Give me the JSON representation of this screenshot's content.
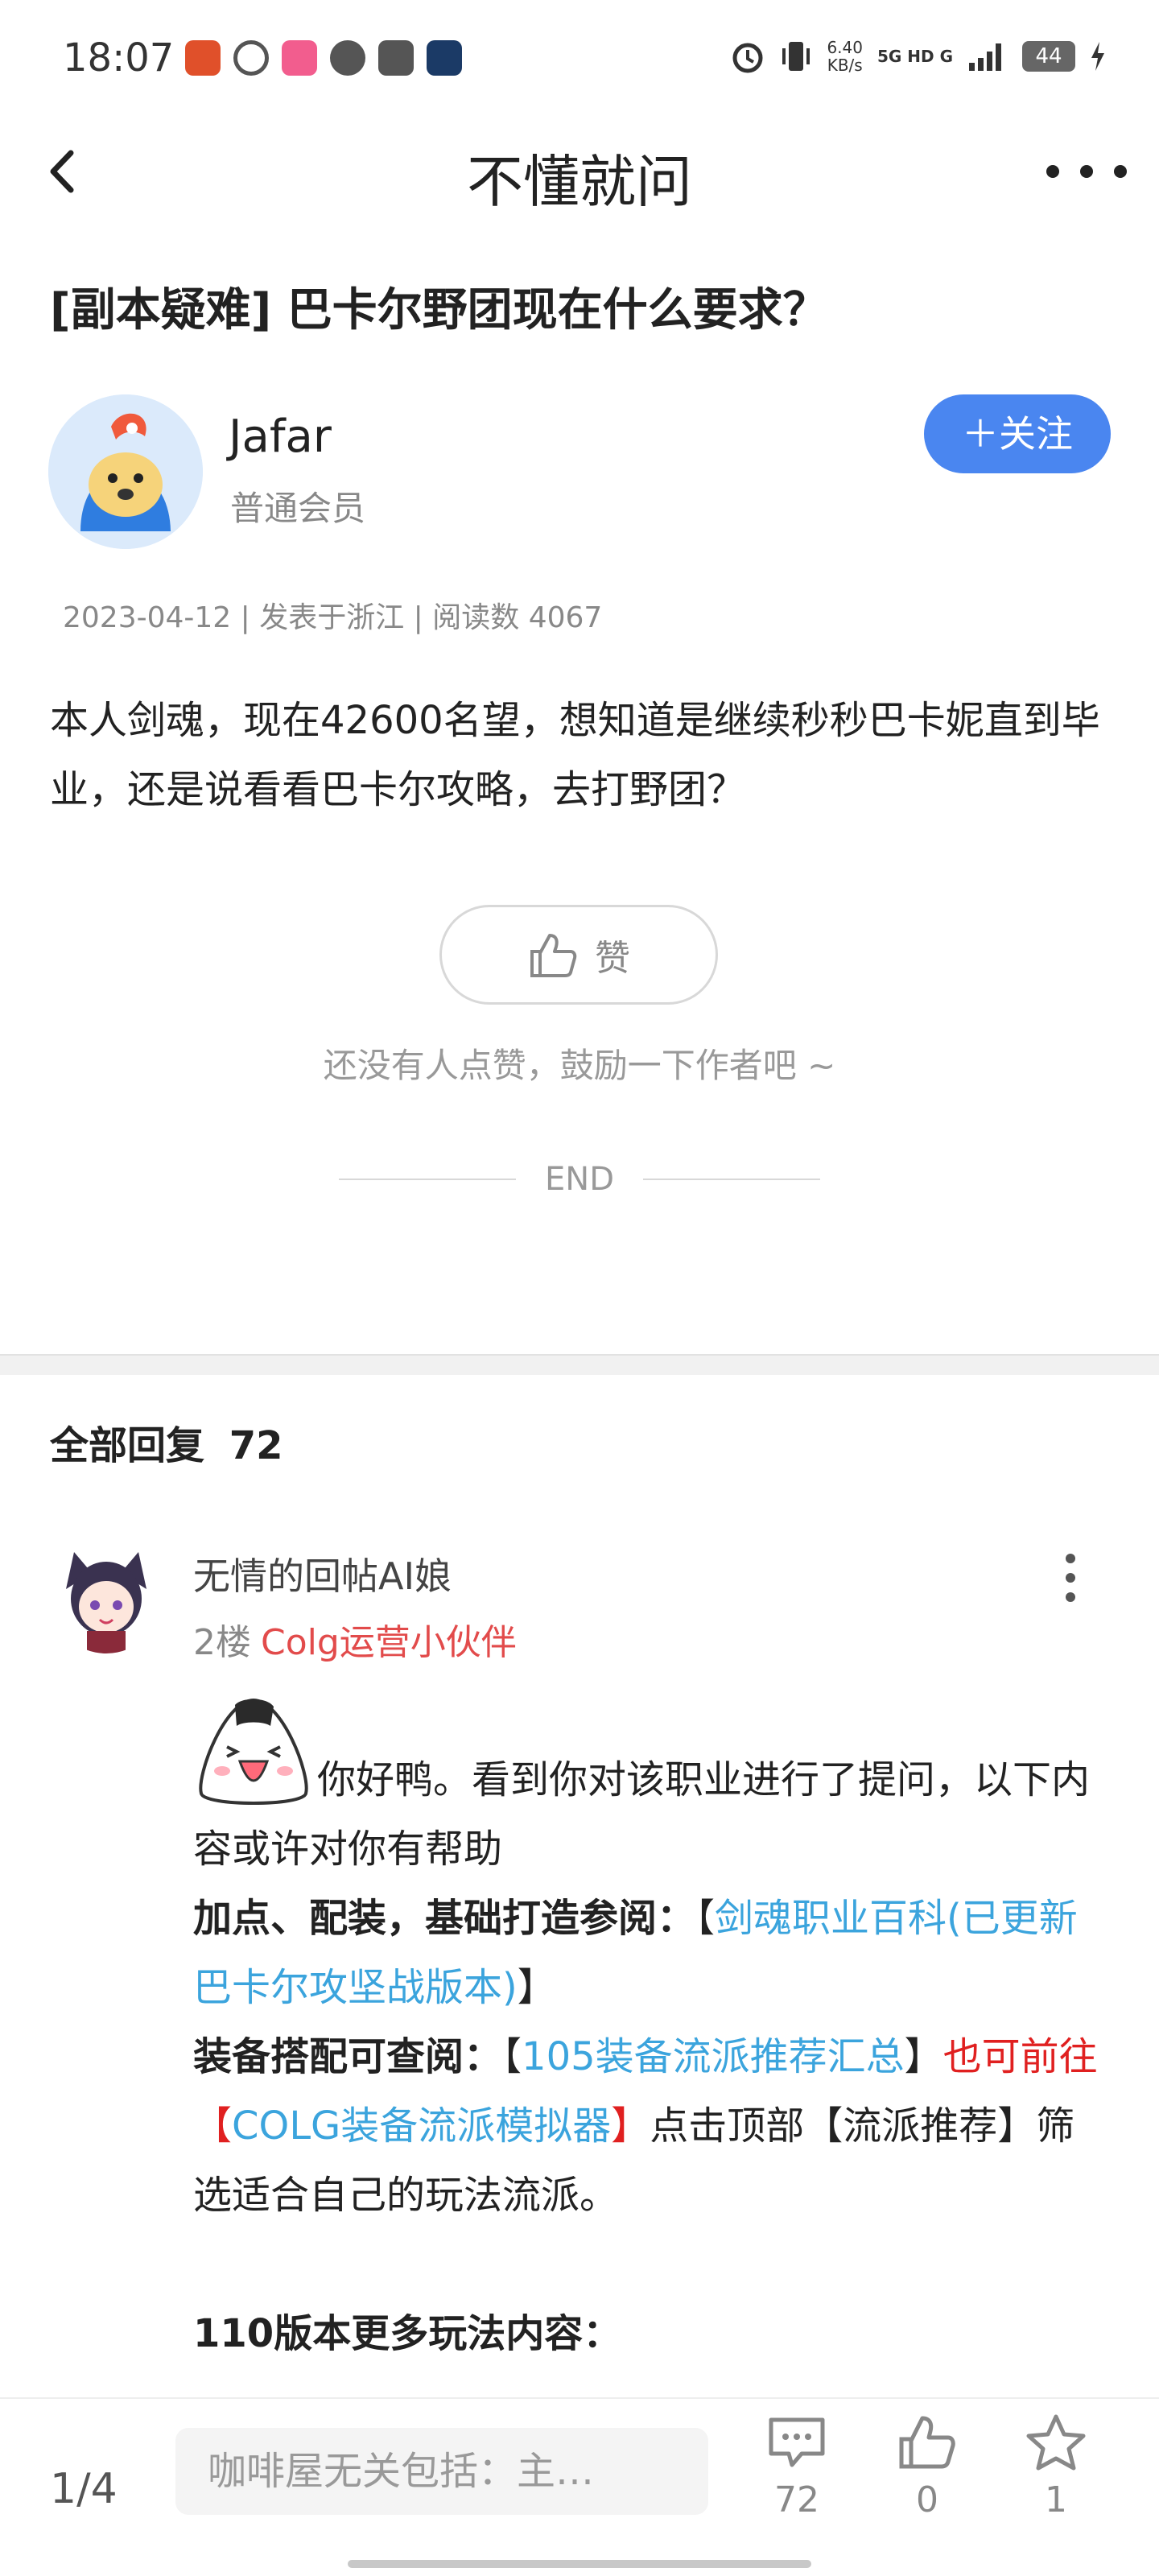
{
  "status_bar": {
    "time": "18:07",
    "net_speed_value": "6.40",
    "net_speed_unit": "KB/s",
    "network": "5G HD G",
    "battery": "44",
    "icons": [
      "alarm-icon",
      "vibrate-icon",
      "signal-icon",
      "battery-icon",
      "charging-icon"
    ]
  },
  "nav": {
    "title": "不懂就问"
  },
  "post": {
    "title": "[副本疑难] 巴卡尔野团现在什么要求？",
    "author": {
      "name": "Jafar",
      "rank": "普通会员"
    },
    "follow_label": "＋关注",
    "meta": "2023-04-12 | 发表于浙江 | 阅读数 4067",
    "body": "本人剑魂，现在42600名望，想知道是继续秒秒巴卡妮直到毕业，还是说看看巴卡尔攻略，去打野团？",
    "like_label": "赞",
    "like_hint": "还没有人点赞，鼓励一下作者吧 ~",
    "end_text": "END"
  },
  "replies": {
    "title": "全部回复",
    "count": "72",
    "items": [
      {
        "name": "无情的回帖AI娘",
        "floor": "2楼",
        "role": "Colg运营小伙伴",
        "intro": "你好鸭。看到你对该职业进行了提问，以下内容或许对你有帮助",
        "line1_label": "加点、配装，基础打造参阅：",
        "line1_open": "【",
        "line1_link": "剑魂职业百科(已更新巴卡尔攻坚战版本)",
        "line1_close": "】",
        "line2_label": "装备搭配可查阅：",
        "line2_open": "【",
        "line2_link": "105装备流派推荐汇总",
        "line2_close": "】",
        "line2_mid": "也可前往【",
        "line2_link2": "COLG装备流派模拟器",
        "line2_mid2": "】",
        "line2_tail": "点击顶部【流派推荐】筛选适合自己的玩法流派。",
        "line3_label": "110版本更多玩法内容："
      }
    ]
  },
  "bottom_bar": {
    "page": "1/4",
    "input_placeholder": "咖啡屋无关包括：主…",
    "comment_count": "72",
    "like_count": "0",
    "favorite_count": "1"
  },
  "colors": {
    "accent": "#4a86f0",
    "link": "#3ba4dd",
    "role": "#e24b4b",
    "highlight_red": "#e02020"
  }
}
